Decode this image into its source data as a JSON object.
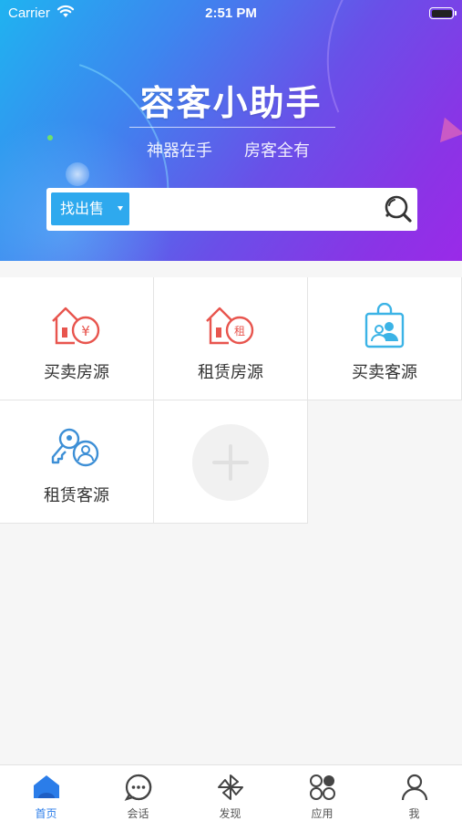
{
  "status_bar": {
    "carrier": "Carrier",
    "time": "2:51 PM"
  },
  "header": {
    "title": "容客小助手",
    "slogan_left": "神器在手",
    "slogan_right": "房客全有"
  },
  "search": {
    "type_label": "找出售",
    "input_value": "",
    "placeholder": ""
  },
  "grid": {
    "items": [
      {
        "label": "买卖房源",
        "icon": "house-yuan-icon",
        "color": "#e8554e"
      },
      {
        "label": "租赁房源",
        "icon": "house-rent-icon",
        "color": "#e8554e"
      },
      {
        "label": "买卖客源",
        "icon": "shopping-bag-people-icon",
        "color": "#3bb3e6"
      },
      {
        "label": "租赁客源",
        "icon": "key-person-icon",
        "color": "#3d8fd6"
      }
    ],
    "add_icon": "plus-icon"
  },
  "tabbar": {
    "items": [
      {
        "label": "首页",
        "icon": "home-icon",
        "active": true
      },
      {
        "label": "会话",
        "icon": "chat-icon",
        "active": false
      },
      {
        "label": "发现",
        "icon": "pinwheel-icon",
        "active": false
      },
      {
        "label": "应用",
        "icon": "apps-icon",
        "active": false
      },
      {
        "label": "我",
        "icon": "person-icon",
        "active": false
      }
    ]
  },
  "colors": {
    "accent": "#2ea9ee",
    "tab_active": "#2b7de9",
    "house_red": "#e8554e",
    "client_blue": "#3bb3e6"
  }
}
